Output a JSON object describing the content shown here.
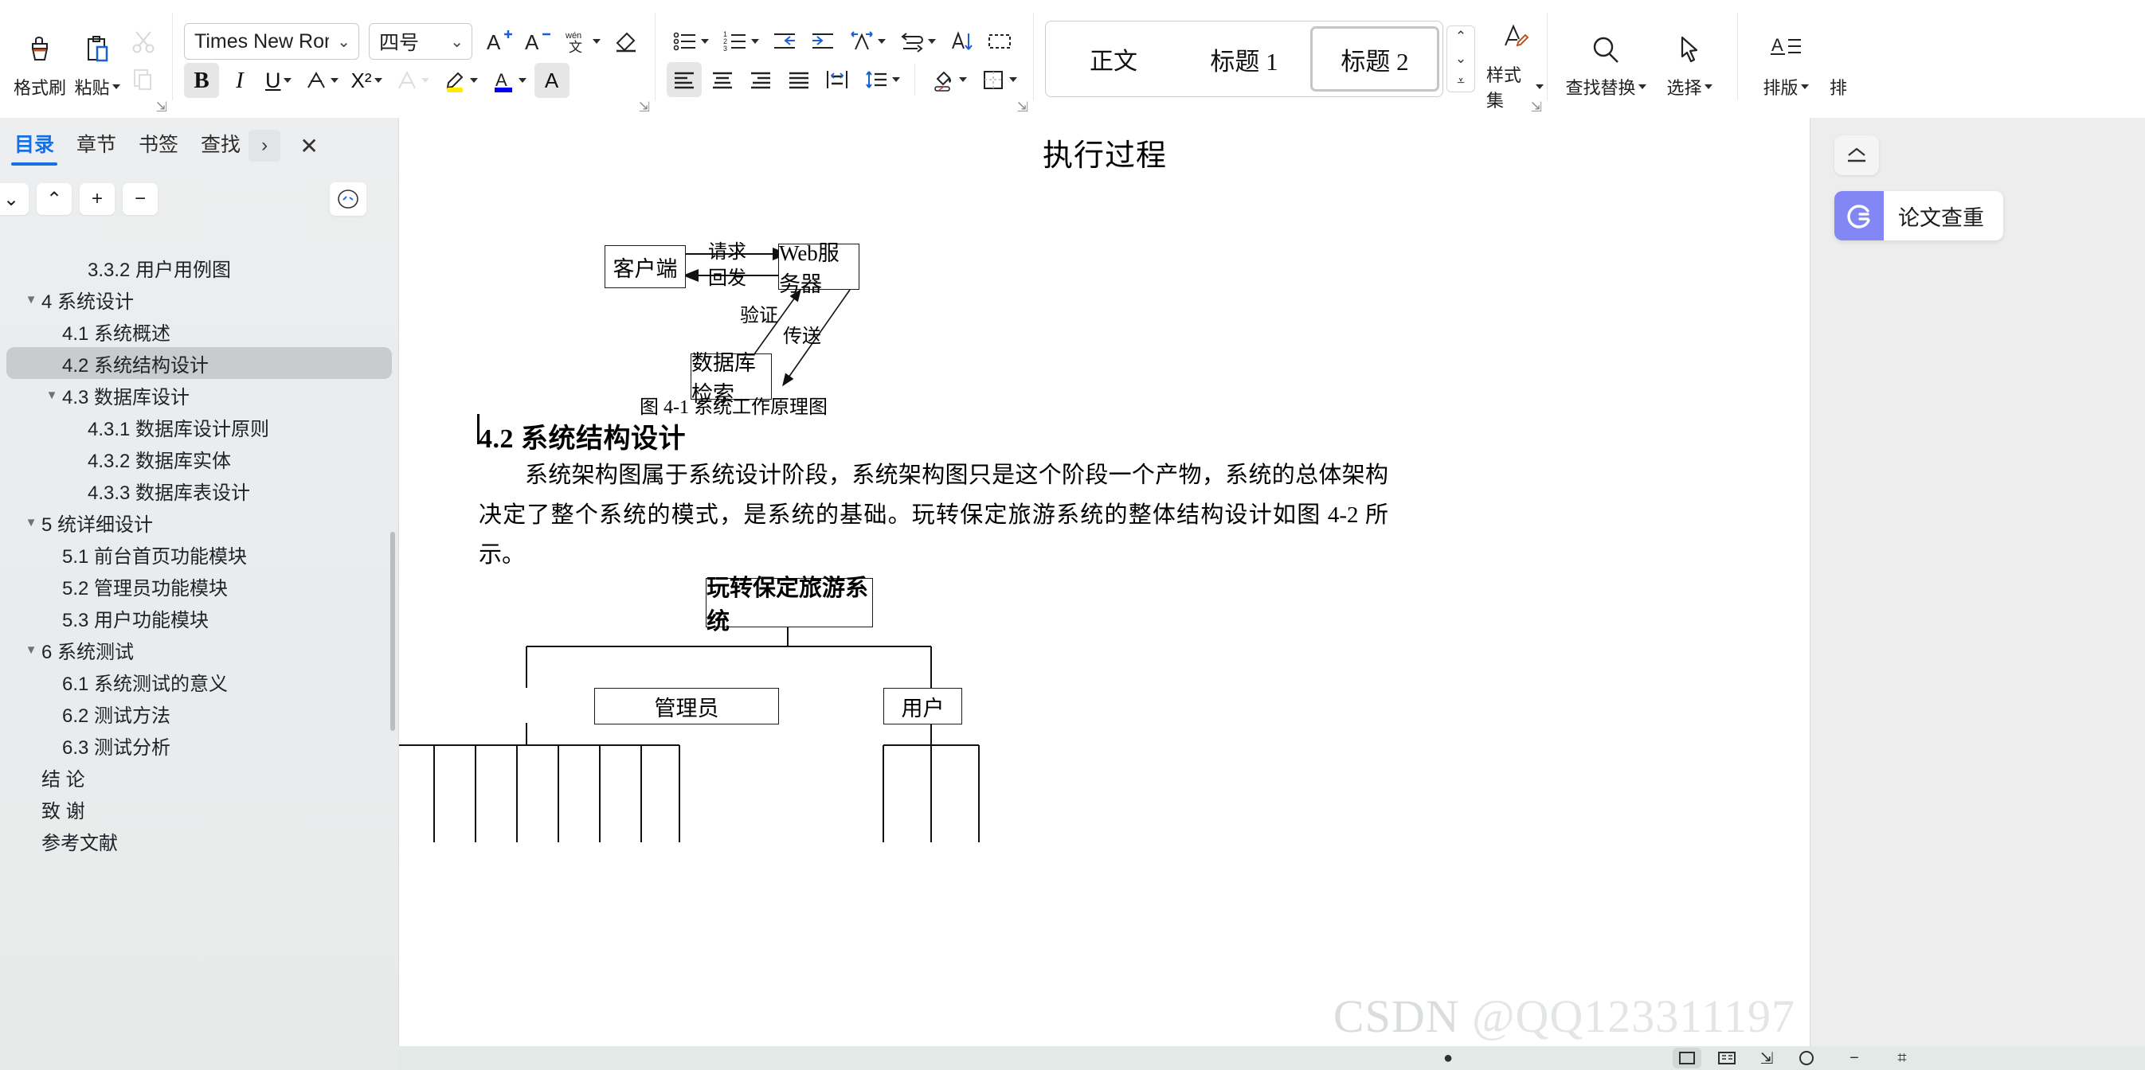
{
  "ribbon": {
    "clipboard": {
      "format_painter": "格式刷",
      "paste": "粘贴",
      "cut_icon": "scissors-icon",
      "copy_icon": "copy-icon"
    },
    "font": {
      "font_family": "Times New Roman",
      "font_size": "四号",
      "grow_font": "A+",
      "shrink_font": "A-",
      "pinyin": "wén",
      "bold": "B",
      "italic": "I",
      "underline": "U",
      "strikethrough": "A",
      "superscript": "X²",
      "highlight_color": "#ffec00",
      "font_color": "#0000ee"
    },
    "paragraph": {
      "bullets": "bullet-list",
      "numbering": "numbered-list",
      "decrease_indent": "decrease-indent",
      "increase_indent": "increase-indent",
      "align_left": "align-left",
      "align_center": "align-center",
      "align_right": "align-right",
      "justify": "justify",
      "distribute": "distribute",
      "line_spacing": "line-spacing"
    },
    "styles": {
      "items": [
        {
          "label": "正文",
          "selected": false
        },
        {
          "label": "标题 1",
          "selected": false
        },
        {
          "label": "标题 2",
          "selected": true
        }
      ],
      "style_set": "样式集"
    },
    "editing": {
      "find_replace": "查找替换",
      "select": "选择"
    },
    "typeset": {
      "layout": "排版",
      "more": "排"
    }
  },
  "nav": {
    "tabs": [
      {
        "label": "目录",
        "active": true
      },
      {
        "label": "章节",
        "active": false
      },
      {
        "label": "书签",
        "active": false
      },
      {
        "label": "查找",
        "active": false
      }
    ],
    "more_icon": "chevron-right-icon",
    "close_icon": "close-icon",
    "tools": {
      "collapse_down": "chevron-down",
      "collapse_up": "chevron-up",
      "expand_plus": "+",
      "collapse_minus": "−",
      "smart_icon": "smart-toc-icon"
    },
    "toc": [
      {
        "label": "3.3.2 用户用例图",
        "level": 3,
        "twisty": "none",
        "selected": false
      },
      {
        "label": "4 系统设计",
        "level": 1,
        "twisty": "open",
        "selected": false
      },
      {
        "label": "4.1 系统概述",
        "level": 2,
        "twisty": "none",
        "selected": false
      },
      {
        "label": "4.2 系统结构设计",
        "level": 2,
        "twisty": "none",
        "selected": true
      },
      {
        "label": "4.3 数据库设计",
        "level": 2,
        "twisty": "open",
        "selected": false
      },
      {
        "label": "4.3.1 数据库设计原则",
        "level": 3,
        "twisty": "none",
        "selected": false
      },
      {
        "label": "4.3.2 数据库实体",
        "level": 3,
        "twisty": "none",
        "selected": false
      },
      {
        "label": "4.3.3 数据库表设计",
        "level": 3,
        "twisty": "none",
        "selected": false
      },
      {
        "label": "5 统详细设计",
        "level": 1,
        "twisty": "open",
        "selected": false
      },
      {
        "label": "5.1 前台首页功能模块",
        "level": 2,
        "twisty": "none",
        "selected": false
      },
      {
        "label": "5.2 管理员功能模块",
        "level": 2,
        "twisty": "none",
        "selected": false
      },
      {
        "label": "5.3 用户功能模块",
        "level": 2,
        "twisty": "none",
        "selected": false
      },
      {
        "label": "6 系统测试",
        "level": 1,
        "twisty": "open",
        "selected": false
      },
      {
        "label": "6.1 系统测试的意义",
        "level": 2,
        "twisty": "none",
        "selected": false
      },
      {
        "label": "6.2 测试方法",
        "level": 2,
        "twisty": "none",
        "selected": false
      },
      {
        "label": "6.3 测试分析",
        "level": 2,
        "twisty": "none",
        "selected": false
      },
      {
        "label": "结    论",
        "level": 1,
        "twisty": "none",
        "selected": false
      },
      {
        "label": "致    谢",
        "level": 1,
        "twisty": "none",
        "selected": false
      },
      {
        "label": "参考文献",
        "level": 1,
        "twisty": "none",
        "selected": false
      }
    ]
  },
  "document": {
    "section_title": "执行过程",
    "figure1": {
      "boxes": {
        "client": "客户端",
        "web_server": "Web服务器",
        "database": "数据库检索"
      },
      "arrow_labels": {
        "request": "请求",
        "reply": "回发",
        "verify": "验证",
        "transmit": "传送"
      },
      "caption": "图 4-1  系统工作原理图"
    },
    "heading": "4.2  系统结构设计",
    "body": "系统架构图属于系统设计阶段，系统架构图只是这个阶段一个产物，系统的总体架构决定了整个系统的模式，是系统的基础。玩转保定旅游系统的整体结构设计如图 4-2 所示。",
    "figure2": {
      "root": "玩转保定旅游系统",
      "admin": "管理员",
      "user": "用户"
    }
  },
  "rail": {
    "collapse_icon": "collapse-ribbon-icon",
    "plagiarism_check": "论文查重",
    "brand_color": "#8287f5"
  },
  "watermark": {
    "site": "CSDN",
    "handle": "@QQ123311197"
  }
}
